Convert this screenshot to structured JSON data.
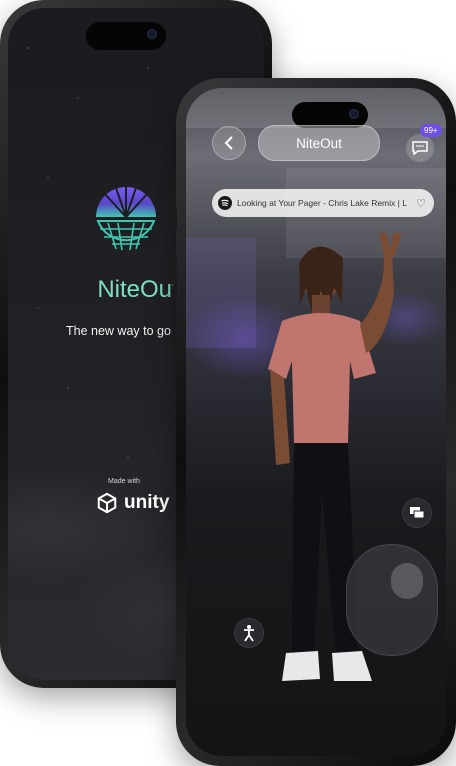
{
  "splash": {
    "brand": "NiteOut",
    "tagline": "The new way to go out",
    "made_with": "Made with",
    "engine": "unity",
    "colors": {
      "brand": "#7ee0c0",
      "logo_top": "#6f4fe8",
      "logo_bottom": "#3fc7b0"
    }
  },
  "game": {
    "title": "NiteOut",
    "notification_badge": "99+",
    "music": {
      "track": "Looking at Your Pager - Chris Lake Remix | L",
      "icon": "spotify-icon"
    },
    "icons": [
      "chevron-left-icon",
      "chat-icon",
      "heart-icon",
      "emote-chat-icon",
      "dance-icon"
    ],
    "colors": {
      "accent": "#6f4fe8"
    }
  }
}
